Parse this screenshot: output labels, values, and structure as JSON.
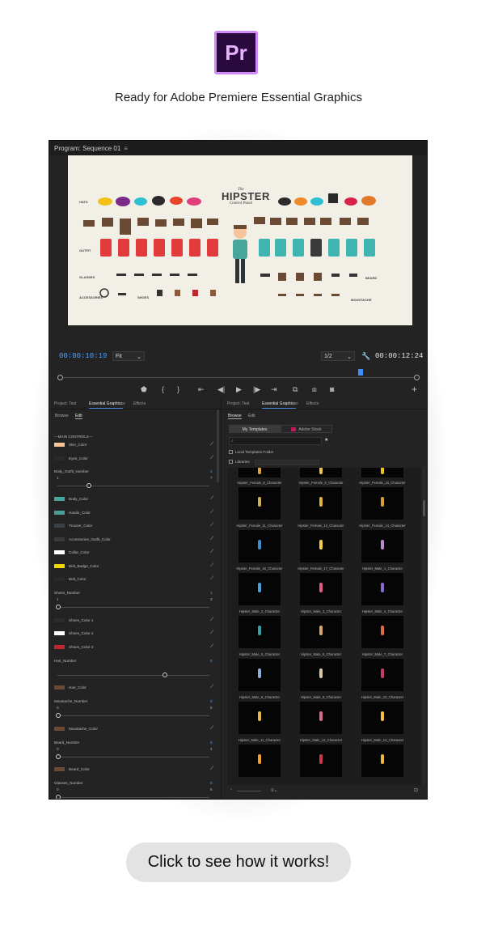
{
  "header": {
    "logo_text": "Pr",
    "tagline": "Ready for Adobe Premiere Essential Graphics"
  },
  "monitor": {
    "title": "Program: Sequence 01",
    "timecode_left": "00:00:10:19",
    "fit": "Fit",
    "resolution": "1/2",
    "timecode_right": "00:00:12:24",
    "playhead_fraction": 0.83
  },
  "preview": {
    "title_the": "The",
    "title_main": "HIPSTER",
    "title_sub": "Control Panel",
    "labels": {
      "hats": "HATS",
      "outfit": "OUTFIT",
      "glasses": "GLASSES",
      "accessories": "ACCESSORIES",
      "shoes": "SHOES",
      "beard": "BEARD",
      "moustache": "MOUSTACHE"
    }
  },
  "left_panel": {
    "tabs": [
      "Project: Test",
      "Essential Graphics",
      "Effects"
    ],
    "subtabs": [
      "Browse",
      "Edit"
    ],
    "section": "---MAIN CONTROLS---",
    "colors": [
      {
        "label": "Skin_Color",
        "color": "#f7c49a"
      },
      {
        "label": "Eyes_Color",
        "color": "#2a2a2a"
      },
      {
        "label": "Body_Color",
        "color": "#46a59c"
      },
      {
        "label": "Hands_Color",
        "color": "#4a9e96"
      },
      {
        "label": "Trouser_Color",
        "color": "#3a3f44"
      },
      {
        "label": "Accessories_Outfit_Color",
        "color": "#3b3b3b"
      },
      {
        "label": "Collar_Color",
        "color": "#ffffff"
      },
      {
        "label": "Belt_Badge_Color",
        "color": "#f2d600"
      },
      {
        "label": "Belt_Color",
        "color": "#2a2a2a"
      },
      {
        "label": "Shoes_Color 1",
        "color": "#2c2c2c"
      },
      {
        "label": "Shoes_Color 2",
        "color": "#ffffff"
      },
      {
        "label": "Shoes_Color 3",
        "color": "#c0262d"
      },
      {
        "label": "Hair_Color",
        "color": "#6b4a33"
      },
      {
        "label": "Moustache_Color",
        "color": "#6b4a33"
      },
      {
        "label": "Beard_Color",
        "color": "#6b4a33"
      }
    ],
    "sliders": [
      {
        "label": "Body_Outfit_Number",
        "value": "2",
        "min": "1",
        "max": "7",
        "fraction": 0.2
      },
      {
        "label": "Shoes_Number",
        "value": "1",
        "min": "1",
        "max": "3",
        "fraction": 0.0
      },
      {
        "label": "Hair_Number",
        "value": "5",
        "min": "",
        "max": "",
        "fraction": 0.7
      },
      {
        "label": "Moustache_Number",
        "value": "0",
        "min": "0",
        "max": "5",
        "fraction": 0.0
      },
      {
        "label": "Beard_Number",
        "value": "0",
        "min": "0",
        "max": "4",
        "fraction": 0.0
      },
      {
        "label": "Glasses_Number",
        "value": "0",
        "min": "0",
        "max": "6",
        "fraction": 0.0
      }
    ]
  },
  "right_panel": {
    "tabs": [
      "Project: Test",
      "Essential Graphics",
      "Effects"
    ],
    "subtabs": [
      "Browse",
      "Edit"
    ],
    "my_templates": "My Templates",
    "adobe_stock": "Adobe Stock",
    "local_templates": "Local Templates Folder",
    "libraries": "Libraries",
    "templates": [
      "Hipster_Female_8_Character",
      "Hipster_Female_9_Character",
      "Hipster_Female_10_Character",
      "Hipster_Female_11_Character",
      "Hipster_Female_12_Character",
      "Hipster_Female_14_Character",
      "Hipster_Female_16_Character",
      "Hipster_Female_17_Character",
      "Hipster_Male_1_Character",
      "Hipster_Male_2_Character",
      "Hipster_Male_3_Character",
      "Hipster_Male_4_Character",
      "Hipster_Male_5_Character",
      "Hipster_Male_6_Character",
      "Hipster_Male_7_Character",
      "Hipster_Male_8_Character",
      "Hipster_Male_9_Character",
      "Hipster_Male_10_Character",
      "Hipster_Male_11_Character",
      "Hipster_Male_12_Character",
      "Hipster_Male_13_Character"
    ],
    "figure_colors": [
      "#d9a441",
      "#e8c24a",
      "#f0c419",
      "#c9b05a",
      "#e2b23e",
      "#d4a133",
      "#3e8ed0",
      "#f2d14a",
      "#b88ad0",
      "#4aa0d8",
      "#e05a8a",
      "#8a6acb",
      "#3aa0a8",
      "#d8a86a",
      "#e26a4a",
      "#8fb0d8",
      "#d8c8a8",
      "#c83a6a",
      "#e2b84a",
      "#d86a8a",
      "#f0c040",
      "#f0a030",
      "#c83a4a",
      "#e8b840"
    ]
  },
  "cta": {
    "label": "Click to see how it works!"
  }
}
